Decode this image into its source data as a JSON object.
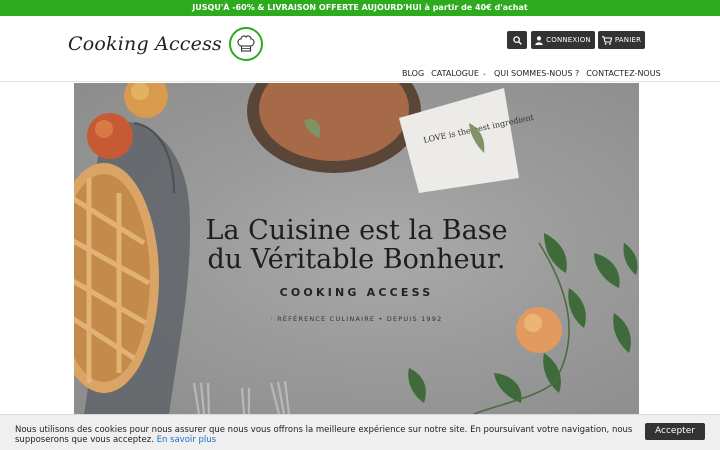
{
  "promo": {
    "text": "JUSQU'À -60% & LIVRAISON OFFERTE AUJOURD'HUI à partir de 40€ d'achat"
  },
  "header": {
    "logo_text": "Cooking Access",
    "login_label": "CONNEXION",
    "cart_label": "PANIER"
  },
  "nav": {
    "items": [
      "BLOG",
      "CATALOGUE",
      "QUI SOMMES-NOUS ?",
      "CONTACTEZ-NOUS"
    ]
  },
  "hero": {
    "title_line1": "La Cuisine est la Base",
    "title_line2": "du Véritable Bonheur.",
    "brand": "COOKING ACCESS",
    "tagline": "· RÉFÉRENCE CULINAIRE • DEPUIS 1992",
    "napkin_text": "LOVE is the best ingredient"
  },
  "cookie": {
    "text": "Nous utilisons des cookies pour nous assurer que nous vous offrons la meilleure expérience sur notre site. En poursuivant votre navigation, nous supposerons que vous acceptez.",
    "link_label": "En savoir plus",
    "accept_label": "Accepter"
  },
  "colors": {
    "promo_green": "#2eaa1f",
    "button_dark": "#333333",
    "link_blue": "#1a6fc7"
  },
  "icons": [
    "search-icon",
    "user-icon",
    "cart-icon",
    "chef-hat-icon",
    "chevron-down-icon"
  ]
}
